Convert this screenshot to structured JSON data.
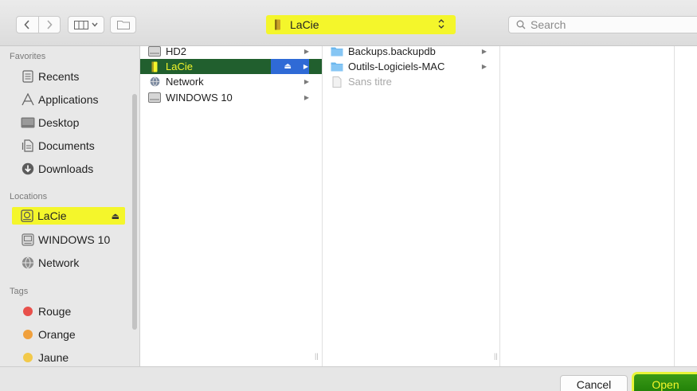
{
  "toolbar": {
    "path_label": "LaCie",
    "search_placeholder": "Search"
  },
  "sidebar": {
    "favorites_header": "Favorites",
    "favorites": [
      {
        "label": "Recents",
        "icon": "recents-icon"
      },
      {
        "label": "Applications",
        "icon": "applications-icon"
      },
      {
        "label": "Desktop",
        "icon": "desktop-icon"
      },
      {
        "label": "Documents",
        "icon": "documents-icon"
      },
      {
        "label": "Downloads",
        "icon": "downloads-icon"
      }
    ],
    "locations_header": "Locations",
    "locations": [
      {
        "label": "LaCie",
        "icon": "external-drive-icon",
        "eject": "⏏"
      },
      {
        "label": "WINDOWS 10",
        "icon": "disk-icon"
      },
      {
        "label": "Network",
        "icon": "network-globe-icon"
      }
    ],
    "tags_header": "Tags",
    "tags": [
      {
        "label": "Rouge",
        "color": "#e8504b"
      },
      {
        "label": "Orange",
        "color": "#f0a03c"
      },
      {
        "label": "Jaune",
        "color": "#f2c94a"
      }
    ]
  },
  "column1": [
    {
      "label": "HD2",
      "icon": "disk-icon"
    },
    {
      "label": "LaCie",
      "icon": "external-drive-icon",
      "selected": true
    },
    {
      "label": "Network",
      "icon": "network-globe-icon"
    },
    {
      "label": "WINDOWS 10",
      "icon": "disk-icon"
    }
  ],
  "column2": [
    {
      "label": "Backups.backupdb",
      "icon": "folder-icon"
    },
    {
      "label": "Outils-Logiciels-MAC",
      "icon": "folder-icon"
    },
    {
      "label": "Sans titre",
      "icon": "document-icon",
      "dim": true
    }
  ],
  "buttons": {
    "cancel": "Cancel",
    "open": "Open"
  },
  "colors": {
    "highlight_yellow": "#f4f62b",
    "selection_green": "#215f2e",
    "selection_blue": "#2f6ad6",
    "open_green": "#2a8c0f"
  }
}
